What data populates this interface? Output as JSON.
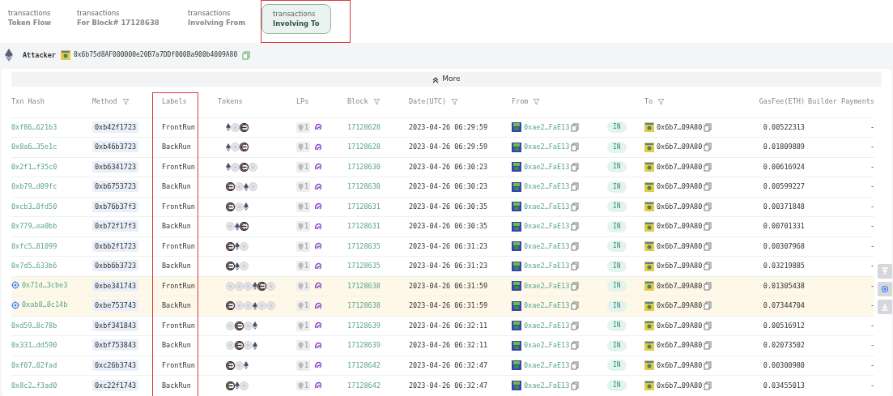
{
  "tabs": [
    {
      "caption": "transactions",
      "label": "Token Flow",
      "selected": false
    },
    {
      "caption": "transactions",
      "label": "For Block# 17128638",
      "selected": false
    },
    {
      "caption": "transactions",
      "label": "Involving From",
      "selected": false
    },
    {
      "caption": "transactions",
      "label": "Involving To",
      "selected": true
    }
  ],
  "attacker": {
    "label": "Attacker",
    "address": "0x6b75d8AF000000e20B7a7DDf000Ba900b4009A80"
  },
  "more_button": "More",
  "table": {
    "columns": [
      {
        "label": "Txn Hash",
        "filterable": false
      },
      {
        "label": "Method",
        "filterable": true
      },
      {
        "label": "Labels",
        "filterable": false
      },
      {
        "label": "Tokens",
        "filterable": false
      },
      {
        "label": "LPs",
        "filterable": false
      },
      {
        "label": "Block",
        "filterable": true
      },
      {
        "label": "Date(UTC)",
        "filterable": true
      },
      {
        "label": "From",
        "filterable": true
      },
      {
        "label": "To",
        "filterable": true
      },
      {
        "label": "GasFee(ETH)",
        "filterable": false
      },
      {
        "label": "Builder Payments",
        "filterable": false
      }
    ],
    "rows": [
      {
        "highlighted": false,
        "hash": "0xf86…621b3",
        "method": "0xb42f1723",
        "label": "FrontRun",
        "tokens": [
          {
            "kind": "eth"
          },
          {
            "kind": "coin"
          },
          {
            "kind": "e"
          }
        ],
        "lps": "1",
        "block": "17128628",
        "date": "2023-04-26 06:29:59",
        "from": "0xae2…FaE13",
        "direction": "IN",
        "to": "0x6b7…09A80",
        "gas_fee": "0.00522313",
        "builder_payment": "-"
      },
      {
        "highlighted": false,
        "hash": "0x8a6…35e1c",
        "method": "0xb46b3723",
        "label": "BackRun",
        "tokens": [
          {
            "kind": "eth"
          },
          {
            "kind": "coin"
          },
          {
            "kind": "e"
          }
        ],
        "lps": "1",
        "block": "17128628",
        "date": "2023-04-26 06:29:59",
        "from": "0xae2…FaE13",
        "direction": "IN",
        "to": "0x6b7…09A80",
        "gas_fee": "0.01809889",
        "builder_payment": "-"
      },
      {
        "highlighted": false,
        "hash": "0x2f1…f35c0",
        "method": "0xb6341723",
        "label": "FrontRun",
        "tokens": [
          {
            "kind": "eth"
          },
          {
            "kind": "coin"
          },
          {
            "kind": "e"
          },
          {
            "kind": "coin"
          }
        ],
        "lps": "1",
        "block": "17128630",
        "date": "2023-04-26 06:30:23",
        "from": "0xae2…FaE13",
        "direction": "IN",
        "to": "0x6b7…09A80",
        "gas_fee": "0.00616924",
        "builder_payment": "-"
      },
      {
        "highlighted": false,
        "hash": "0xb79…d09fc",
        "method": "0xb6753723",
        "label": "BackRun",
        "tokens": [
          {
            "kind": "e"
          },
          {
            "kind": "coin"
          },
          {
            "kind": "eth"
          },
          {
            "kind": "coin"
          }
        ],
        "lps": "1",
        "block": "17128630",
        "date": "2023-04-26 06:30:23",
        "from": "0xae2…FaE13",
        "direction": "IN",
        "to": "0x6b7…09A80",
        "gas_fee": "0.00599227",
        "builder_payment": "-"
      },
      {
        "highlighted": false,
        "hash": "0xcb3…0fd50",
        "method": "0xb76b37f3",
        "label": "FrontRun",
        "tokens": [
          {
            "kind": "e"
          },
          {
            "kind": "coin"
          },
          {
            "kind": "eth"
          }
        ],
        "lps": "1",
        "block": "17128631",
        "date": "2023-04-26 06:30:35",
        "from": "0xae2…FaE13",
        "direction": "IN",
        "to": "0x6b7…09A80",
        "gas_fee": "0.00371848",
        "builder_payment": "-"
      },
      {
        "highlighted": false,
        "hash": "0x779…ea0bb",
        "method": "0xb72f17f3",
        "label": "BackRun",
        "tokens": [
          {
            "kind": "coin"
          },
          {
            "kind": "eth"
          },
          {
            "kind": "e"
          }
        ],
        "lps": "1",
        "block": "17128631",
        "date": "2023-04-26 06:30:35",
        "from": "0xae2…FaE13",
        "direction": "IN",
        "to": "0x6b7…09A80",
        "gas_fee": "0.00701331",
        "builder_payment": "-"
      },
      {
        "highlighted": false,
        "hash": "0xfc5…81099",
        "method": "0xbb2f1723",
        "label": "FrontRun",
        "tokens": [
          {
            "kind": "e"
          },
          {
            "kind": "eth"
          },
          {
            "kind": "coin"
          }
        ],
        "lps": "1",
        "block": "17128635",
        "date": "2023-04-26 06:31:23",
        "from": "0xae2…FaE13",
        "direction": "IN",
        "to": "0x6b7…09A80",
        "gas_fee": "0.00307968",
        "builder_payment": "-"
      },
      {
        "highlighted": false,
        "hash": "0x7d5…633b6",
        "method": "0xbb6b3723",
        "label": "BackRun",
        "tokens": [
          {
            "kind": "e"
          },
          {
            "kind": "eth"
          },
          {
            "kind": "coin"
          }
        ],
        "lps": "1",
        "block": "17128635",
        "date": "2023-04-26 06:31:23",
        "from": "0xae2…FaE13",
        "direction": "IN",
        "to": "0x6b7…09A80",
        "gas_fee": "0.03219885",
        "builder_payment": "-"
      },
      {
        "highlighted": true,
        "hash": "0x71d…3cbe3",
        "method": "0xbe341743",
        "label": "FrontRun",
        "tokens": [
          {
            "kind": "coin"
          },
          {
            "kind": "coin"
          },
          {
            "kind": "coin"
          },
          {
            "kind": "eth"
          },
          {
            "kind": "e"
          },
          {
            "kind": "coin"
          }
        ],
        "lps": "1",
        "block": "17128638",
        "date": "2023-04-26 06:31:59",
        "from": "0xae2…FaE13",
        "direction": "IN",
        "to": "0x6b7…09A80",
        "gas_fee": "0.01305438",
        "builder_payment": "-"
      },
      {
        "highlighted": true,
        "hash": "0xab8…8c14b",
        "method": "0xbe753743",
        "label": "BackRun",
        "tokens": [
          {
            "kind": "e"
          },
          {
            "kind": "coin"
          },
          {
            "kind": "coin"
          },
          {
            "kind": "eth"
          },
          {
            "kind": "coin"
          },
          {
            "kind": "coin"
          }
        ],
        "lps": "1",
        "block": "17128638",
        "date": "2023-04-26 06:31:59",
        "from": "0xae2…FaE13",
        "direction": "IN",
        "to": "0x6b7…09A80",
        "gas_fee": "0.07344704",
        "builder_payment": "-"
      },
      {
        "highlighted": false,
        "hash": "0xd59…8c78b",
        "method": "0xbf341843",
        "label": "FrontRun",
        "tokens": [
          {
            "kind": "coin"
          },
          {
            "kind": "e"
          },
          {
            "kind": "coin"
          },
          {
            "kind": "eth"
          }
        ],
        "lps": "1",
        "block": "17128639",
        "date": "2023-04-26 06:32:11",
        "from": "0xae2…FaE13",
        "direction": "IN",
        "to": "0x6b7…09A80",
        "gas_fee": "0.00516912",
        "builder_payment": "-"
      },
      {
        "highlighted": false,
        "hash": "0x331…dd590",
        "method": "0xbf753843",
        "label": "BackRun",
        "tokens": [
          {
            "kind": "coin"
          },
          {
            "kind": "e"
          },
          {
            "kind": "coin"
          },
          {
            "kind": "eth"
          }
        ],
        "lps": "1",
        "block": "17128639",
        "date": "2023-04-26 06:32:11",
        "from": "0xae2…FaE13",
        "direction": "IN",
        "to": "0x6b7…09A80",
        "gas_fee": "0.02073502",
        "builder_payment": "-"
      },
      {
        "highlighted": false,
        "hash": "0xf07…02fad",
        "method": "0xc26b3743",
        "label": "FrontRun",
        "tokens": [
          {
            "kind": "e"
          },
          {
            "kind": "coin"
          },
          {
            "kind": "eth"
          }
        ],
        "lps": "1",
        "block": "17128642",
        "date": "2023-04-26 06:32:47",
        "from": "0xae2…FaE13",
        "direction": "IN",
        "to": "0x6b7…09A80",
        "gas_fee": "0.00300980",
        "builder_payment": "-"
      },
      {
        "highlighted": false,
        "hash": "0x8c2…f3ad0",
        "method": "0xc22f1743",
        "label": "BackRun",
        "tokens": [
          {
            "kind": "e"
          },
          {
            "kind": "eth"
          },
          {
            "kind": "coin"
          }
        ],
        "lps": "1",
        "block": "17128642",
        "date": "2023-04-26 06:32:47",
        "from": "0xae2…FaE13",
        "direction": "IN",
        "to": "0x6b7…09A80",
        "gas_fee": "0.03455013",
        "builder_payment": "-"
      }
    ]
  }
}
